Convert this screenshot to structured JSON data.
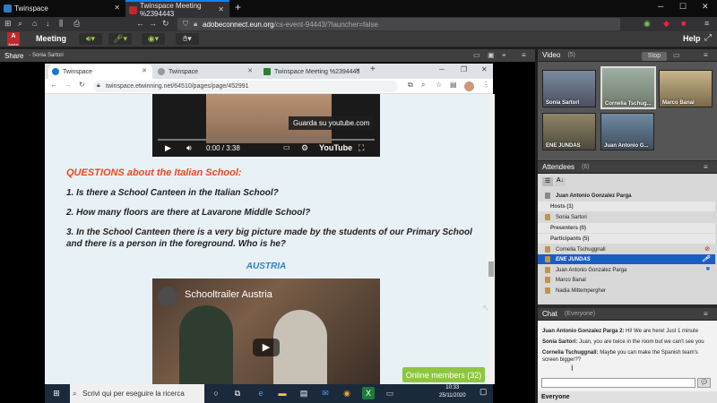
{
  "firefox": {
    "tabs": [
      {
        "label": "Twinspace",
        "active": false
      },
      {
        "label": "Twinspace Meeting %2394443",
        "active": true
      }
    ],
    "url_host": "adobeconnect.eun.org",
    "url_rest": "/cs-event-94443/?launcher=false"
  },
  "adobe": {
    "logo": "Adobe",
    "meeting_menu": "Meeting",
    "help_menu": "Help"
  },
  "share_pod": {
    "title": "Share",
    "presenter": "- Sonia Sartori"
  },
  "chrome": {
    "tabs": [
      {
        "label": "Twinspace",
        "active": true
      },
      {
        "label": "Twinspace",
        "active": false
      },
      {
        "label": "Twinspace Meeting %2394443",
        "active": false
      }
    ],
    "url": "twinspace.etwinning.net/64510/pages/page/452991"
  },
  "page": {
    "video1": {
      "tooltip": "Guarda su youtube.com",
      "time": "0:00 / 3:38",
      "brand": "YouTube"
    },
    "questions_title": "QUESTIONS about the Italian School:",
    "questions": [
      "1. Is there a School Canteen in the Italian School?",
      "2.  How many floors are there at Lavarone Middle School?",
      "3. In the School Canteen there is a very big picture made by the students of our Primary School",
      "and there is a person in the foreground. Who is he?"
    ],
    "section": "AUSTRIA",
    "video2_title": "Schooltrailer Austria",
    "online_members": "Online members (32)"
  },
  "taskbar": {
    "search_placeholder": "Scrivi qui per eseguire la ricerca",
    "time": "10:33",
    "date": "25/11/2020"
  },
  "video_pod": {
    "title": "Video",
    "count": "(5)",
    "stop_label": "Stop",
    "tiles": [
      "Sonia Sartori",
      "Cornelia Tschug...",
      "Marco Banal",
      "ENE JUNDAS",
      "Juan Antonio G..."
    ]
  },
  "attendees_pod": {
    "title": "Attendees",
    "count": "(6)",
    "me": "Juan Antonio Gonzalez Parga",
    "hosts_label": "Hosts (1)",
    "hosts": [
      "Sonia Sartori"
    ],
    "presenters_label": "Presenters (0)",
    "participants_label": "Participants (5)",
    "participants": [
      "Cornelia Tschuggnall",
      "ENE JUNDAS",
      "Juan Antonio Gonzalez Parga",
      "Marco Banal",
      "Nadia Mittempergher"
    ]
  },
  "chat_pod": {
    "title": "Chat",
    "scope": "(Everyone)",
    "messages": [
      {
        "sender": "Juan Antonio Gonzalez Parga 2:",
        "text": " Hi! We are here! Just 1 minute"
      },
      {
        "sender": "Sonia Sartori:",
        "text": " Juan, you are twice in the room but we can't see you"
      },
      {
        "sender": "Cornelia Tschuggnall:",
        "text": " Maybe you can make the Spanish team's screen bigger??"
      }
    ],
    "recipient": "Everyone"
  }
}
